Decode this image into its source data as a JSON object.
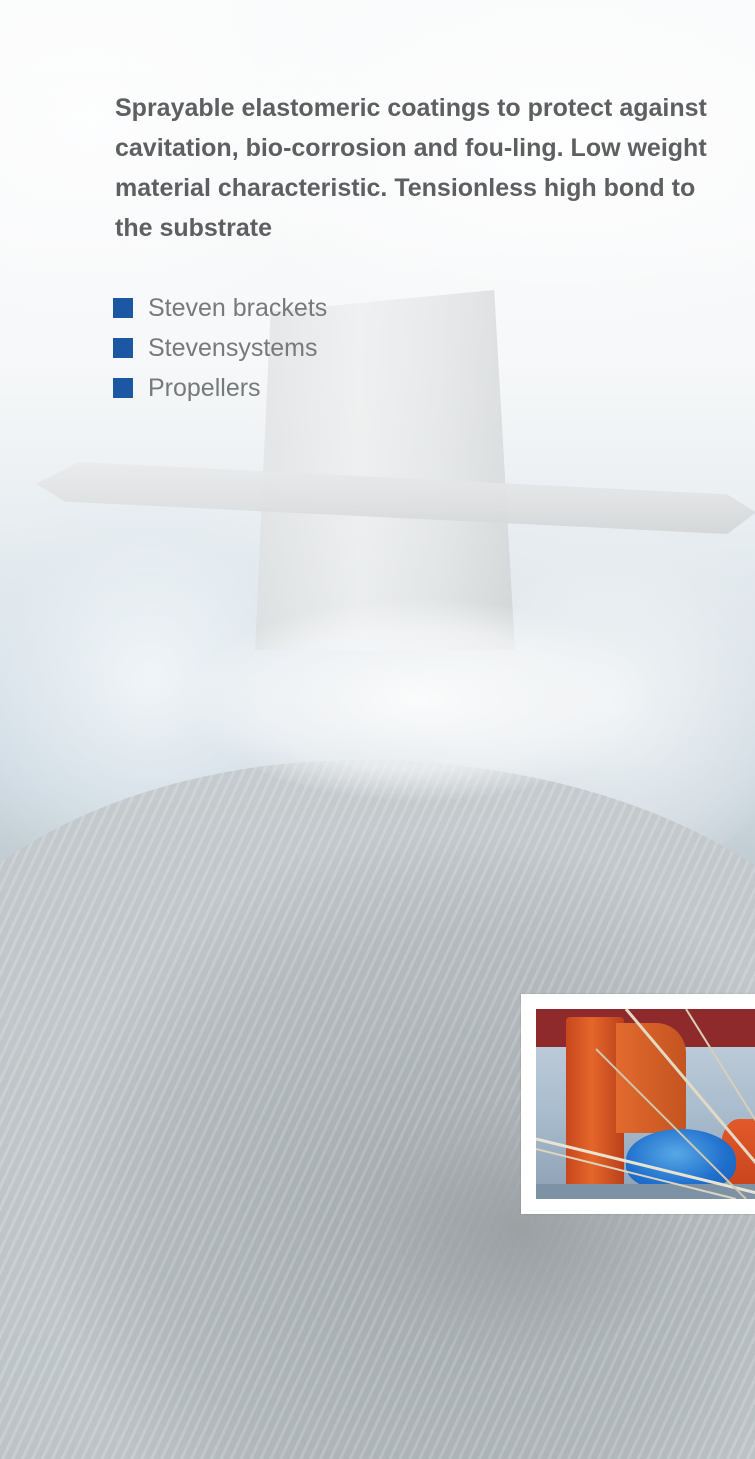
{
  "intro": {
    "text": "Sprayable elastomeric coatings to protect against cavitation, bio-corrosion and fou-ling. Low weight material characteristic. Tensionless high bond to the substrate"
  },
  "bullets": {
    "color": "#1c57a3",
    "items": [
      {
        "label": "Steven brackets"
      },
      {
        "label": "Stevensystems"
      },
      {
        "label": "Propellers"
      }
    ]
  },
  "background": {
    "subject": "submarine tail fins above rough sea (faded)"
  },
  "inset_photo": {
    "subject": "orange rudder and blue propeller on ship stern with ropes"
  }
}
